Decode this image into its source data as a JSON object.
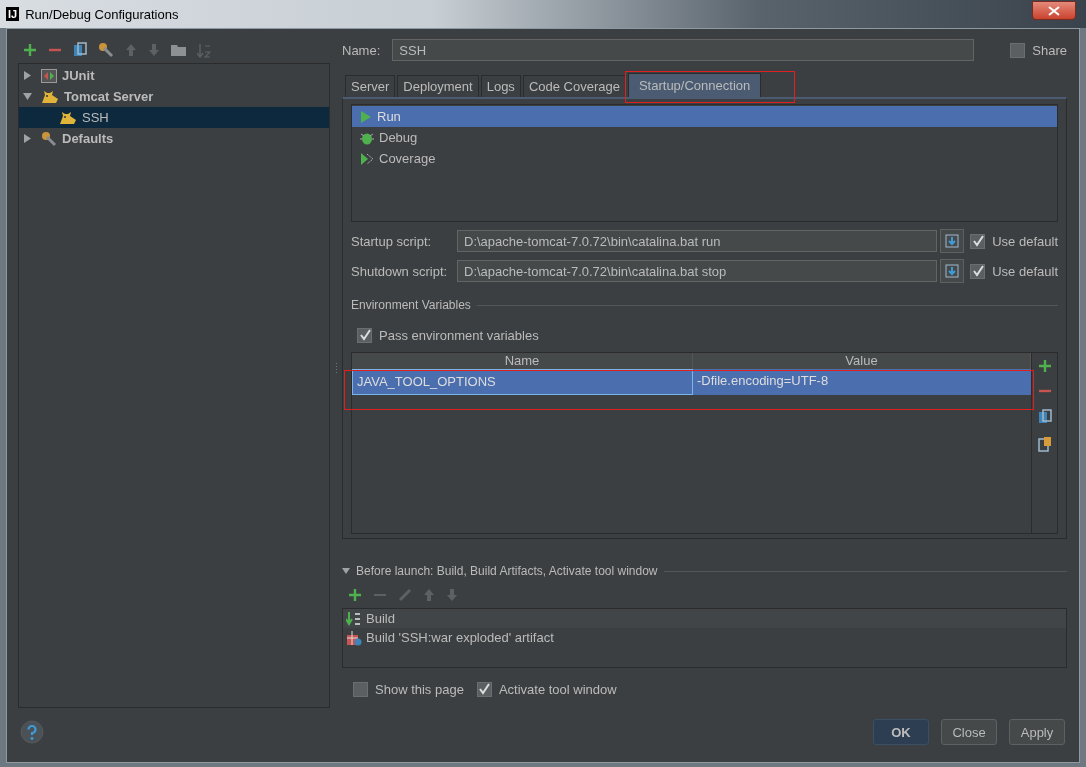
{
  "window": {
    "title": "Run/Debug Configurations",
    "icon_text": "IJ"
  },
  "tree": [
    {
      "label": "JUnit",
      "kind": "junit",
      "expanded": false,
      "selected": false
    },
    {
      "label": "Tomcat Server",
      "kind": "tomcat",
      "expanded": true,
      "selected": false,
      "children": [
        {
          "label": "SSH",
          "kind": "tomcat",
          "selected": true
        }
      ]
    },
    {
      "label": "Defaults",
      "kind": "defaults",
      "expanded": false,
      "selected": false
    }
  ],
  "name_field": {
    "label": "Name:",
    "value": "SSH"
  },
  "share": {
    "label": "Share",
    "checked": false
  },
  "tabs": [
    {
      "label": "Server",
      "selected": false
    },
    {
      "label": "Deployment",
      "selected": false
    },
    {
      "label": "Logs",
      "selected": false
    },
    {
      "label": "Code Coverage",
      "selected": false
    },
    {
      "label": "Startup/Connection",
      "selected": true
    }
  ],
  "run_modes": [
    {
      "label": "Run",
      "kind": "run",
      "selected": true
    },
    {
      "label": "Debug",
      "kind": "debug",
      "selected": false
    },
    {
      "label": "Coverage",
      "kind": "coverage",
      "selected": false
    }
  ],
  "scripts": [
    {
      "label": "Startup script:",
      "value": "D:\\apache-tomcat-7.0.72\\bin\\catalina.bat run",
      "use_default": {
        "label": "Use default",
        "checked": true
      }
    },
    {
      "label": "Shutdown script:",
      "value": "D:\\apache-tomcat-7.0.72\\bin\\catalina.bat stop",
      "use_default": {
        "label": "Use default",
        "checked": true
      }
    }
  ],
  "env": {
    "title": "Environment Variables",
    "pass": {
      "label": "Pass environment variables",
      "checked": true
    },
    "columns": [
      "Name",
      "Value"
    ],
    "rows": [
      {
        "name": "JAVA_TOOL_OPTIONS",
        "value": "-Dfile.encoding=UTF-8",
        "selected": true
      }
    ]
  },
  "before_launch": {
    "title": "Before launch: Build, Build Artifacts, Activate tool window",
    "expanded": true,
    "tasks": [
      {
        "label": "Build",
        "kind": "build"
      },
      {
        "label": "Build 'SSH:war exploded' artifact",
        "kind": "artifact"
      }
    ]
  },
  "options": [
    {
      "label": "Show this page",
      "checked": false
    },
    {
      "label": "Activate tool window",
      "checked": true
    }
  ],
  "buttons": [
    {
      "label": "OK",
      "kind": "primary"
    },
    {
      "label": "Close",
      "kind": "normal"
    },
    {
      "label": "Apply",
      "kind": "normal"
    }
  ]
}
